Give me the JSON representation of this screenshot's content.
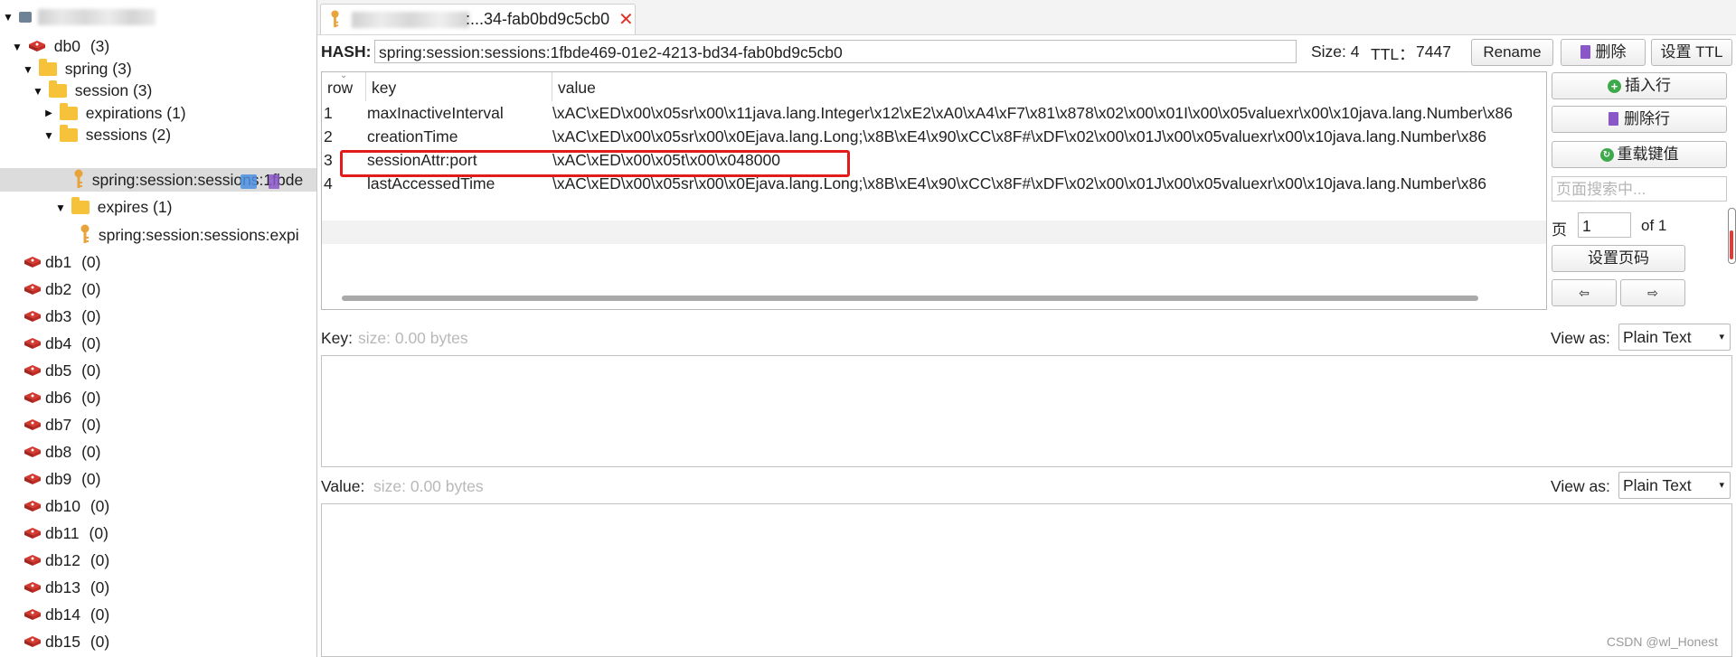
{
  "tree": {
    "db0_label": "db0",
    "db0_count": "(3)",
    "nodes": [
      {
        "label": "spring (3)"
      },
      {
        "label": "session (3)"
      },
      {
        "label": "expirations (1)"
      },
      {
        "label": "sessions (2)"
      },
      {
        "label": "spring:session:sessions:1fbde"
      },
      {
        "label": "expires (1)"
      },
      {
        "label": "spring:session:sessions:expi"
      }
    ],
    "dbs": [
      {
        "name": "db1",
        "count": "(0)"
      },
      {
        "name": "db2",
        "count": "(0)"
      },
      {
        "name": "db3",
        "count": "(0)"
      },
      {
        "name": "db4",
        "count": "(0)"
      },
      {
        "name": "db5",
        "count": "(0)"
      },
      {
        "name": "db6",
        "count": "(0)"
      },
      {
        "name": "db7",
        "count": "(0)"
      },
      {
        "name": "db8",
        "count": "(0)"
      },
      {
        "name": "db9",
        "count": "(0)"
      },
      {
        "name": "db10",
        "count": "(0)"
      },
      {
        "name": "db11",
        "count": "(0)"
      },
      {
        "name": "db12",
        "count": "(0)"
      },
      {
        "name": "db13",
        "count": "(0)"
      },
      {
        "name": "db14",
        "count": "(0)"
      },
      {
        "name": "db15",
        "count": "(0)"
      }
    ]
  },
  "tab": {
    "title": ":...34-fab0bd9c5cb0",
    "close": "✕"
  },
  "header": {
    "type_label": "HASH:",
    "key_name": "spring:session:sessions:1fbde469-01e2-4213-bd34-fab0bd9c5cb0",
    "size_label": "Size: 4",
    "ttl_label": "TTL：",
    "ttl_value": "7447",
    "rename_button": "Rename",
    "delete_button": "删除",
    "set_ttl_button": "设置 TTL"
  },
  "table": {
    "columns": [
      "row",
      "key",
      "value"
    ],
    "rows": [
      {
        "row": "1",
        "key": "maxInactiveInterval",
        "value": "\\xAC\\xED\\x00\\x05sr\\x00\\x11java.lang.Integer\\x12\\xE2\\xA0\\xA4\\xF7\\x81\\x878\\x02\\x00\\x01I\\x00\\x05valuexr\\x00\\x10java.lang.Number\\x86"
      },
      {
        "row": "2",
        "key": "creationTime",
        "value": "\\xAC\\xED\\x00\\x05sr\\x00\\x0Ejava.lang.Long;\\x8B\\xE4\\x90\\xCC\\x8F#\\xDF\\x02\\x00\\x01J\\x00\\x05valuexr\\x00\\x10java.lang.Number\\x86"
      },
      {
        "row": "3",
        "key": "sessionAttr:port",
        "value": "\\xAC\\xED\\x00\\x05t\\x00\\x048000"
      },
      {
        "row": "4",
        "key": "lastAccessedTime",
        "value": "\\xAC\\xED\\x00\\x05sr\\x00\\x0Ejava.lang.Long;\\x8B\\xE4\\x90\\xCC\\x8F#\\xDF\\x02\\x00\\x01J\\x00\\x05valuexr\\x00\\x10java.lang.Number\\x86"
      }
    ]
  },
  "side": {
    "insert_row": "插入行",
    "delete_row": "删除行",
    "reload": "重载键值",
    "search_placeholder": "页面搜索中...",
    "page_label": "页",
    "page_value": "1",
    "page_of": "of 1",
    "set_page": "设置页码",
    "prev": "⇦",
    "next": "⇨"
  },
  "key_pane": {
    "label": "Key:",
    "size": "size: 0.00 bytes",
    "view_as": "View as:",
    "format": "Plain Text"
  },
  "value_pane": {
    "label": "Value:",
    "size": "size: 0.00 bytes",
    "view_as": "View as:",
    "format": "Plain Text"
  },
  "watermark": "CSDN @wl_Honest",
  "colors": {
    "accent_red": "#e21b1b",
    "folder": "#f6c23a",
    "key_icon": "#e8a33a"
  }
}
